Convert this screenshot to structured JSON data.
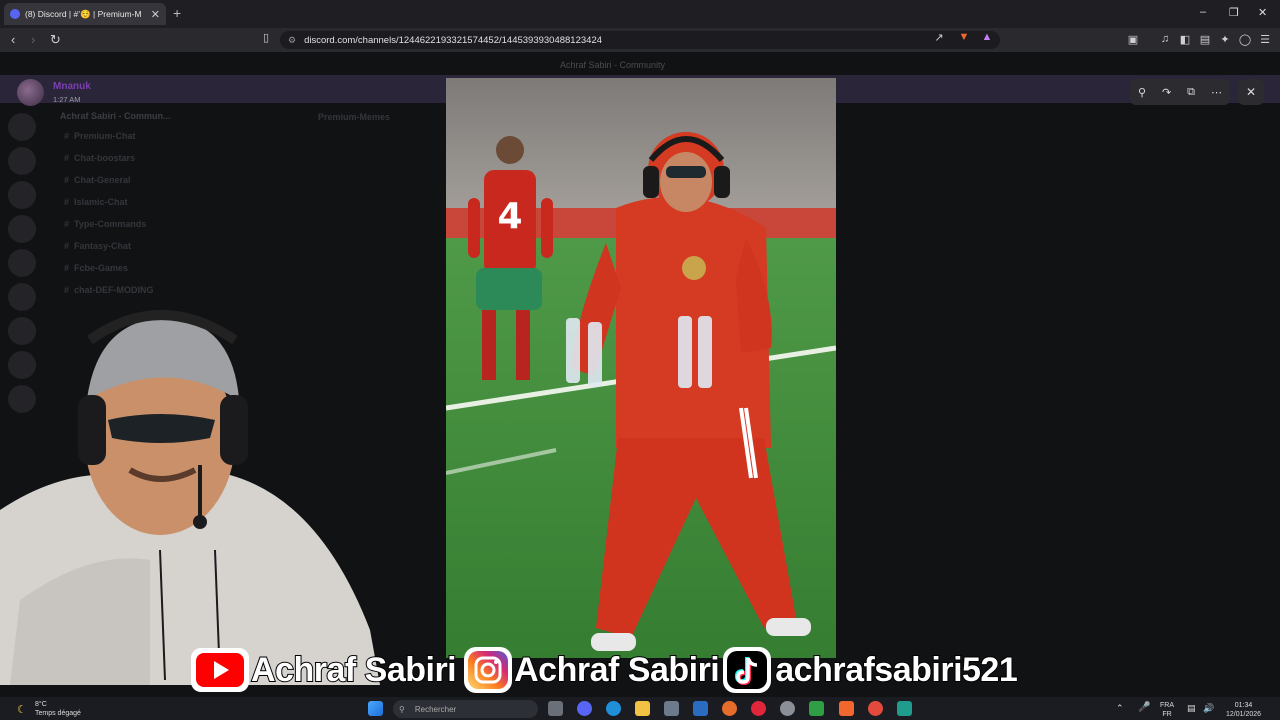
{
  "browser": {
    "tab_title": "(8) Discord | #’☺️ | Premium-M",
    "tab_close": "✕",
    "new_tab": "+",
    "url": "discord.com/channels/1244622193321574452/1445393930488123424",
    "win_minimize": "–",
    "win_restore": "❒",
    "win_close": "✕"
  },
  "discord": {
    "window_title": "Achraf Sabiri - Community",
    "server_name": "Achraf Sabiri - Commun...",
    "channels": [
      "Premium-Chat",
      "Chat-boostars",
      "Chat-General",
      "Islamic-Chat",
      "Type-Commands",
      "Fantasy-Chat",
      "Fcbe-Games",
      "chat-DEF-MODING"
    ],
    "channel_title": "Premium-Memes"
  },
  "image_viewer": {
    "author": "Mnanuk",
    "time": "1:27 AM"
  },
  "banner": {
    "youtube": "Achraf Sabiri",
    "instagram": "Achraf Sabiri",
    "tiktok": "achrafsabiri521"
  },
  "taskbar": {
    "weather_temp": "8°C",
    "weather_desc": "Temps dégagé",
    "search_placeholder": "Rechercher",
    "lang1": "FRA",
    "lang2": "FR",
    "time": "01:34",
    "date": "12/01/2026"
  },
  "colors": {
    "youtube_red": "#ff0000",
    "jersey_red": "#d42e1f",
    "pitch_green": "#3f8a3c",
    "discord_accent": "#7b3fb0"
  }
}
